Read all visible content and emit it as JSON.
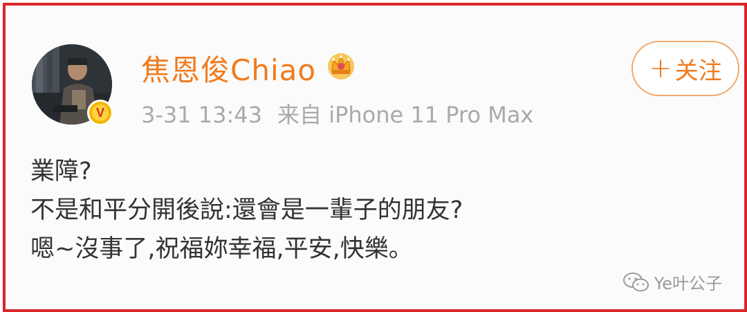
{
  "post": {
    "username": "焦恩俊Chiao",
    "timestamp": "3-31 13:43",
    "source": "来自 iPhone 11 Pro Max",
    "follow_label": "关注",
    "follow_plus": "+",
    "verified_mark": "V",
    "lines": [
      "業障?",
      "不是和平分開後說:還會是一輩子的朋友?",
      "嗯~沒事了,祝福妳幸福,平安,快樂。"
    ]
  },
  "watermark": {
    "label": "Ye叶公子"
  },
  "colors": {
    "border": "#d9262b",
    "username": "#f07b1d",
    "meta": "#a9a9a9",
    "text": "#333333",
    "badge": "#f5b400"
  },
  "icons": {
    "avatar": "avatar-photo",
    "crown": "crown-icon",
    "verified": "verified-v-icon",
    "watermark": "wechat-icon"
  }
}
